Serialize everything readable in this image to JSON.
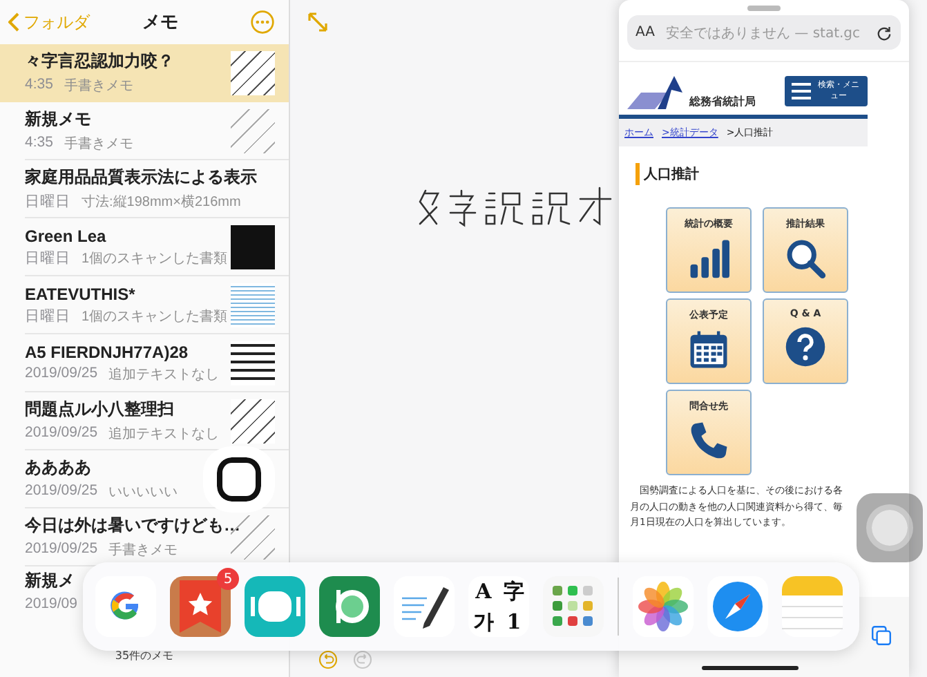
{
  "sidebar": {
    "back_label": "フォルダ",
    "title": "メモ",
    "notes": [
      {
        "title": "々字言忍認加力咬？",
        "date": "4:35",
        "preview": "手書きメモ",
        "selected": true,
        "kind": "sketch"
      },
      {
        "title": "新規メモ",
        "date": "4:35",
        "preview": "手書きメモ",
        "selected": false,
        "kind": "sketch-light"
      },
      {
        "title": "家庭用品品質表示法による表示",
        "date": "日曜日",
        "preview": "寸法:縦198mm×横216mm",
        "selected": false,
        "kind": "plain"
      },
      {
        "title": "Green Lea",
        "date": "日曜日",
        "preview": "1個のスキャンした書類",
        "selected": false,
        "kind": "dark"
      },
      {
        "title": "EATEVUTHIS*",
        "date": "日曜日",
        "preview": "1個のスキャンした書類",
        "selected": false,
        "kind": "scan"
      },
      {
        "title": "A5 FIERDNJH77A)28",
        "date": "2019/09/25",
        "preview": "追加テキストなし",
        "selected": false,
        "kind": "print"
      },
      {
        "title": "問題点ル小八整理扫",
        "date": "2019/09/25",
        "preview": "追加テキストなし",
        "selected": false,
        "kind": "sketch"
      },
      {
        "title": "ああああ",
        "date": "2019/09/25",
        "preview": "いいいいい",
        "selected": false,
        "kind": "zero"
      },
      {
        "title": "今日は外は暑いですけども…",
        "date": "2019/09/25",
        "preview": "手書きメモ",
        "selected": false,
        "kind": "sketch-light"
      },
      {
        "title": "新規メ",
        "date": "2019/09",
        "selected": false,
        "kind": "plain"
      }
    ],
    "footer": "35件のメモ"
  },
  "safari": {
    "text_size_label": "AA",
    "address": "安全ではありません — stat.gc",
    "site_name": "総務省統計局",
    "menu_label": "検索・メニュー",
    "breadcrumbs": [
      {
        "label": "ホーム",
        "link": true
      },
      {
        "label": ">統計データ",
        "link": true
      },
      {
        "label": ">人口推計",
        "link": false
      }
    ],
    "heading": "人口推計",
    "tiles": [
      {
        "label": "統計の概要",
        "kind": "bars"
      },
      {
        "label": "推計結果",
        "kind": "search"
      },
      {
        "label": "公表予定",
        "kind": "calendar"
      },
      {
        "label": "Q & A",
        "kind": "question"
      },
      {
        "label": "問合せ先",
        "kind": "phone"
      }
    ],
    "paragraph": "国勢調査による人口を基に、その後における各月の人口の動きを他の人口関連資料から得て、毎月1日現在の人口を算出しています。"
  },
  "dock": {
    "apps": [
      {
        "kind": "google"
      },
      {
        "kind": "bookmarks",
        "badge": "5"
      },
      {
        "kind": "teal"
      },
      {
        "kind": "green"
      },
      {
        "kind": "pen"
      },
      {
        "kind": "letters",
        "glyphs": [
          "A",
          "字",
          "가",
          "1"
        ]
      },
      {
        "kind": "folder"
      },
      {
        "kind": "divider"
      },
      {
        "kind": "photos"
      },
      {
        "kind": "safari"
      },
      {
        "kind": "notes"
      }
    ]
  }
}
